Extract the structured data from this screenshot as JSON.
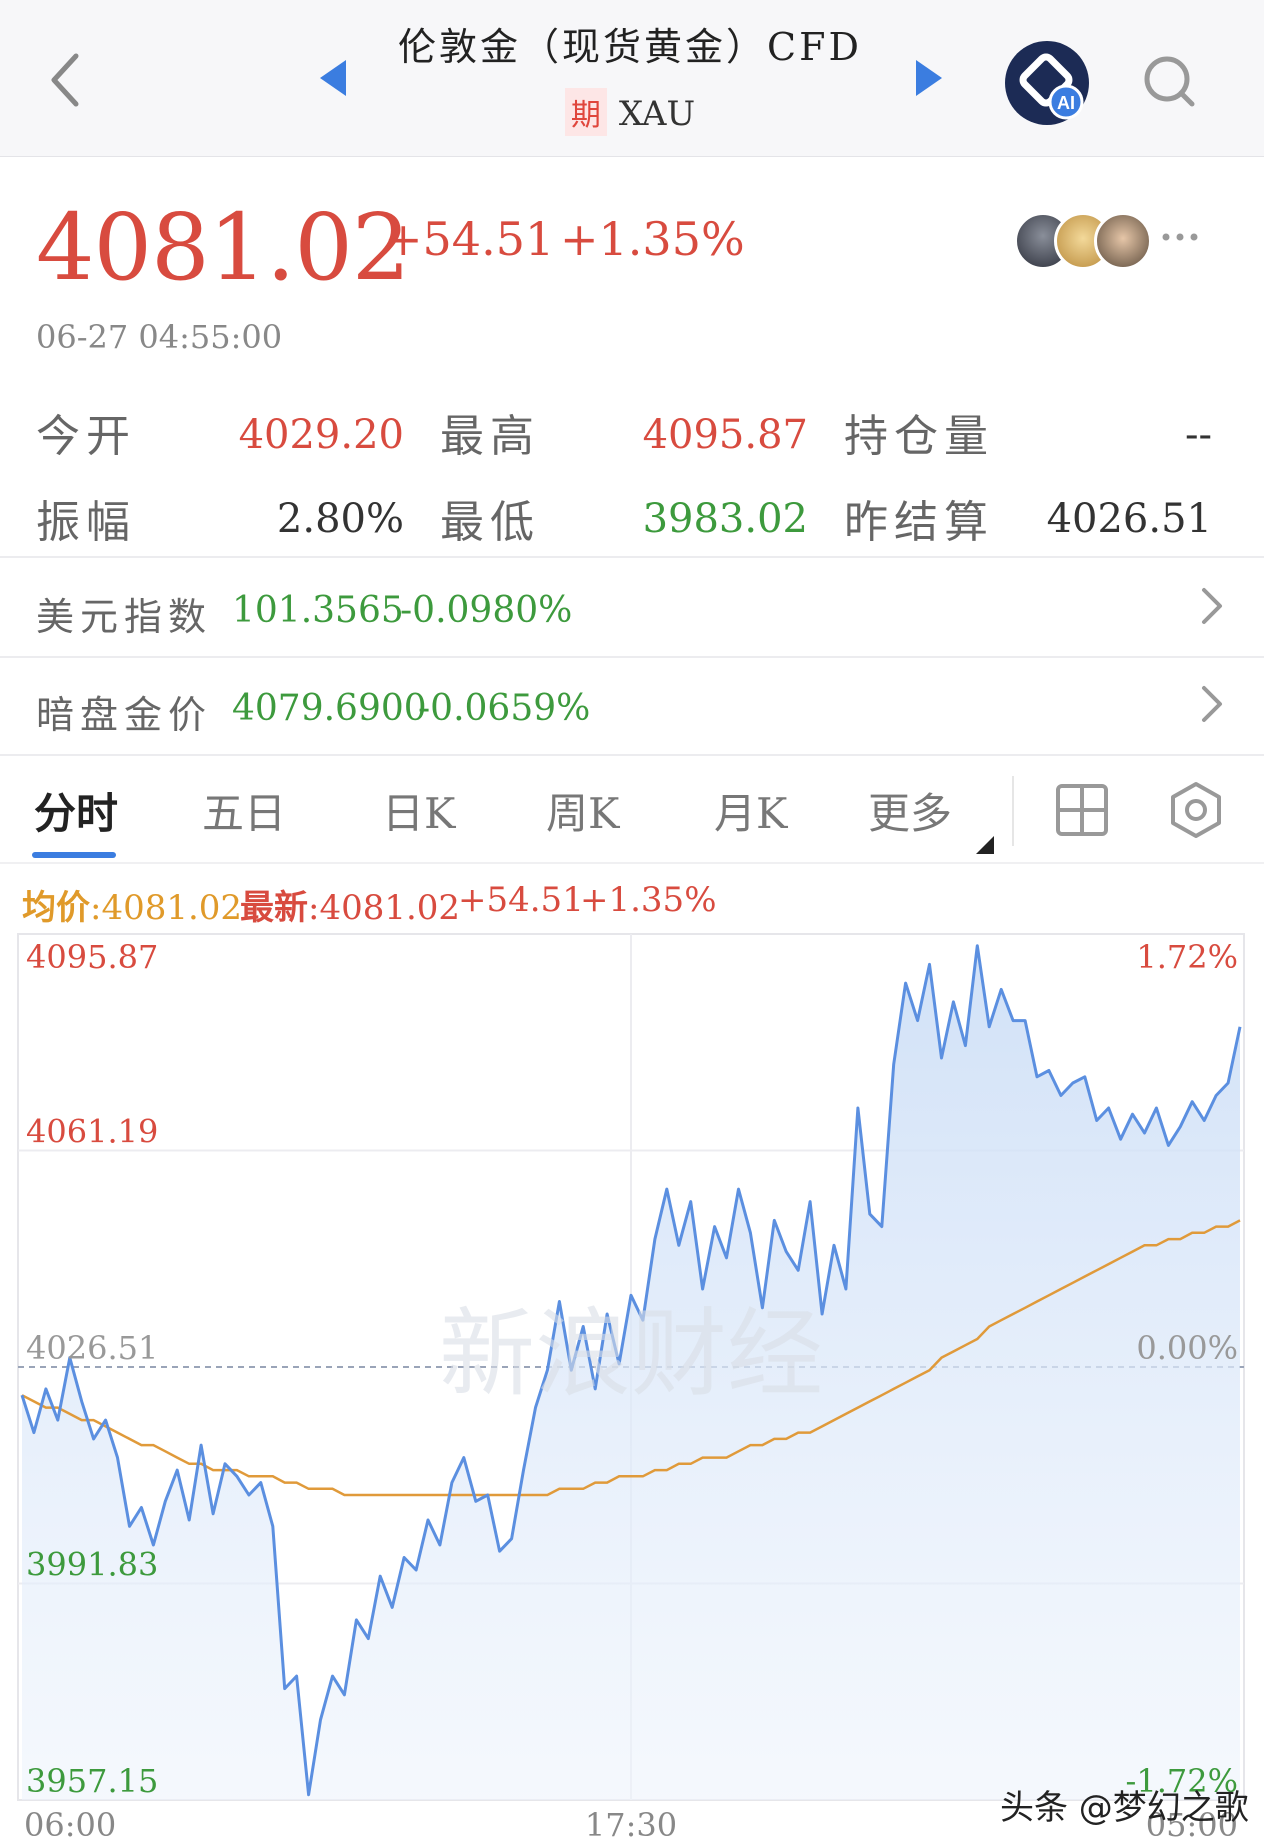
{
  "header": {
    "title": "伦敦金（现货黄金）CFD",
    "badge": "期",
    "symbol": "XAU"
  },
  "quote": {
    "price": "4081.02",
    "change": "+54.51",
    "change_pct": "+1.35%",
    "timestamp": "06-27 04:55:00"
  },
  "stats": [
    {
      "label": "今开",
      "value": "4029.20",
      "color": "#d84b3f"
    },
    {
      "label": "最高",
      "value": "4095.87",
      "color": "#d84b3f"
    },
    {
      "label": "持仓量",
      "value": "--",
      "color": "#333333"
    },
    {
      "label": "振幅",
      "value": "2.80%",
      "color": "#333333"
    },
    {
      "label": "最低",
      "value": "3983.02",
      "color": "#3d9a3d"
    },
    {
      "label": "昨结算",
      "value": "4026.51",
      "color": "#333333"
    }
  ],
  "related": [
    {
      "label": "美元指数",
      "value": "101.3565",
      "pct": "-0.0980%"
    },
    {
      "label": "暗盘金价",
      "value": "4079.6900",
      "pct": "-0.0659%"
    }
  ],
  "tabs": [
    "分时",
    "五日",
    "日K",
    "周K",
    "月K",
    "更多"
  ],
  "active_tab": "分时",
  "legend": {
    "avg_label": "均价",
    "avg_value": ":4081.02",
    "last_label": "最新",
    "last_value": ":4081.02",
    "change": "+54.51",
    "change_pct": "+1.35%"
  },
  "colors": {
    "up": "#d84b3f",
    "down": "#3d9a3d",
    "price_line": "#5b8fe0",
    "avg_line": "#e09a3a",
    "accent": "#3b7de0"
  },
  "chart_data": {
    "type": "line",
    "ylim": [
      3957.15,
      4095.87
    ],
    "y_ticks_left": [
      "4095.87",
      "4061.19",
      "4026.51",
      "3991.83",
      "3957.15"
    ],
    "y_ticks_right": [
      "1.72%",
      "",
      "0.00%",
      "",
      "-1.72%"
    ],
    "x_ticks": [
      "06:00",
      "17:30",
      "05:00"
    ],
    "base": 4026.51,
    "watermark": "新浪财经",
    "series": [
      {
        "values": [
          4022,
          4016,
          4023,
          4018,
          4028,
          4021,
          4015,
          4018,
          4012,
          4001,
          4004,
          3998,
          4005,
          4010,
          4002,
          4014,
          4003,
          4011,
          4009,
          4006,
          4008,
          4001,
          3975,
          3977,
          3958,
          3970,
          3977,
          3974,
          3986,
          3983,
          3993,
          3988,
          3996,
          3994,
          4002,
          3998,
          4008,
          4012,
          4005,
          4006,
          3997,
          3999,
          4010,
          4020,
          4026,
          4037,
          4026,
          4033,
          4023,
          4035,
          4027,
          4038,
          4034,
          4047,
          4055,
          4046,
          4053,
          4039,
          4049,
          4044,
          4055,
          4048,
          4036,
          4050,
          4045,
          4042,
          4053,
          4035,
          4046,
          4039,
          4068,
          4051,
          4049,
          4075,
          4088,
          4082,
          4091,
          4076,
          4085,
          4078,
          4094,
          4081,
          4087,
          4082,
          4082,
          4073,
          4074,
          4070,
          4072,
          4073,
          4066,
          4068,
          4063,
          4067,
          4064,
          4068,
          4062,
          4065,
          4069,
          4066,
          4070,
          4072,
          4081
        ]
      },
      {
        "values": [
          4022,
          4021,
          4020,
          4020,
          4019,
          4018,
          4018,
          4017,
          4016,
          4015,
          4014,
          4014,
          4013,
          4012,
          4011,
          4011,
          4010,
          4010,
          4010,
          4009,
          4009,
          4009,
          4008,
          4008,
          4007,
          4007,
          4007,
          4006,
          4006,
          4006,
          4006,
          4006,
          4006,
          4006,
          4006,
          4006,
          4006,
          4006,
          4006,
          4006,
          4006,
          4006,
          4006,
          4006,
          4006,
          4007,
          4007,
          4007,
          4008,
          4008,
          4009,
          4009,
          4009,
          4010,
          4010,
          4011,
          4011,
          4012,
          4012,
          4012,
          4013,
          4014,
          4014,
          4015,
          4015,
          4016,
          4016,
          4017,
          4018,
          4019,
          4020,
          4021,
          4022,
          4023,
          4024,
          4025,
          4026,
          4028,
          4029,
          4030,
          4031,
          4033,
          4034,
          4035,
          4036,
          4037,
          4038,
          4039,
          4040,
          4041,
          4042,
          4043,
          4044,
          4045,
          4046,
          4046,
          4047,
          4047,
          4048,
          4048,
          4049,
          4049,
          4050
        ]
      }
    ]
  },
  "watermark": "头条 @梦幻之歌"
}
